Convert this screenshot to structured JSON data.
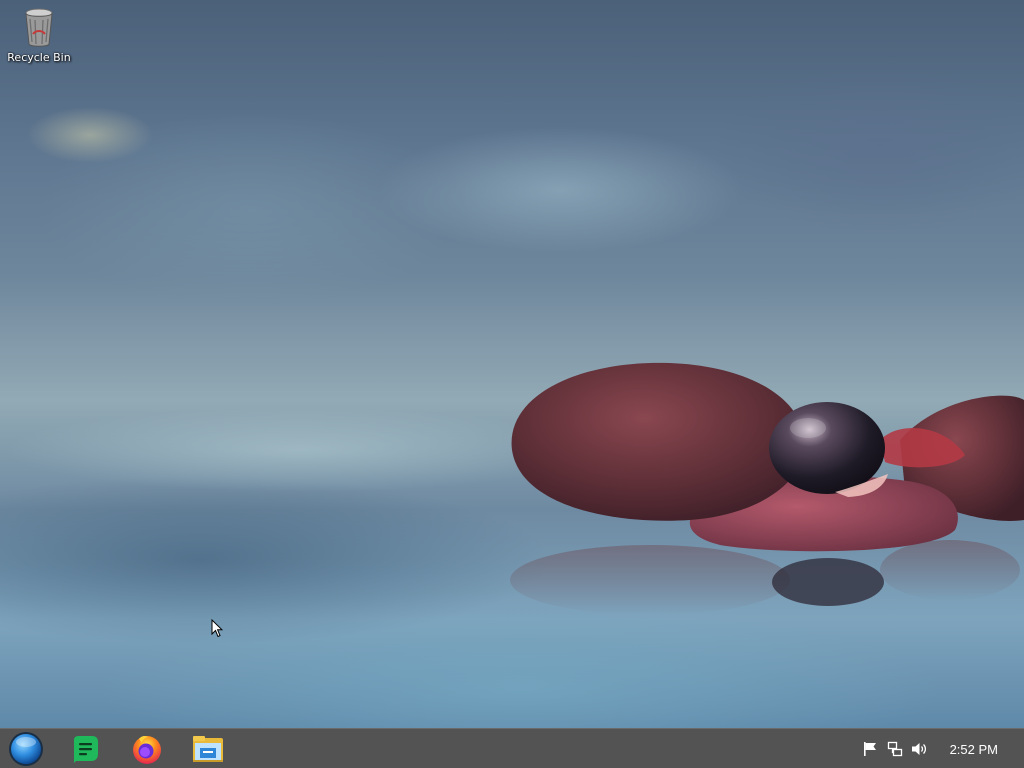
{
  "desktop": {
    "icons": [
      {
        "label": "Recycle Bin",
        "icon": "recycle-bin-icon"
      }
    ]
  },
  "taskbar": {
    "start": {
      "icon": "start-orb-icon"
    },
    "pinned": [
      {
        "icon": "notes-app-icon",
        "color": "#1fb85a"
      },
      {
        "icon": "firefox-icon",
        "color": "#ff7a1a"
      },
      {
        "icon": "file-explorer-icon",
        "color": "#f2c94c"
      }
    ],
    "tray": {
      "icons": [
        "action-center-flag-icon",
        "network-icon",
        "volume-icon"
      ],
      "clock": "2:52 PM"
    }
  },
  "colors": {
    "taskbar": "#535353",
    "text": "#ffffff"
  }
}
